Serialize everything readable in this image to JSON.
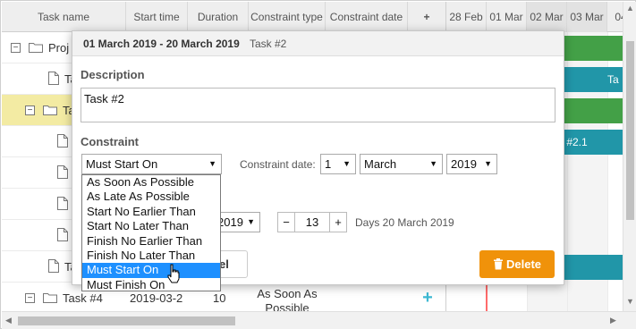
{
  "grid": {
    "columns": [
      {
        "key": "task_name",
        "label": "Task name"
      },
      {
        "key": "start_time",
        "label": "Start time"
      },
      {
        "key": "duration",
        "label": "Duration"
      },
      {
        "key": "constraint_type",
        "label": "Constraint type"
      },
      {
        "key": "constraint_date",
        "label": "Constraint date"
      }
    ],
    "add_icon": "plus-icon",
    "rows": [
      {
        "name": "Proj",
        "type": "project",
        "expanded": true
      },
      {
        "name": "Ta",
        "type": "task"
      },
      {
        "name": "Ta",
        "type": "project",
        "expanded": true,
        "selected": true
      },
      {
        "name": "",
        "type": "task"
      },
      {
        "name": "",
        "type": "task"
      },
      {
        "name": "",
        "type": "task"
      },
      {
        "name": "",
        "type": "task"
      },
      {
        "name": "Ta",
        "type": "task"
      },
      {
        "name": "Task #4",
        "type": "project",
        "expanded": true,
        "start": "2019-03-2",
        "duration": "10",
        "constraint": "As Soon As Possible"
      }
    ]
  },
  "scale": {
    "days": [
      {
        "label": "28 Feb",
        "weekend": false
      },
      {
        "label": "01 Mar",
        "weekend": false
      },
      {
        "label": "02 Mar",
        "weekend": true
      },
      {
        "label": "03 Mar",
        "weekend": true
      },
      {
        "label": "04",
        "weekend": false
      }
    ]
  },
  "timeline": {
    "bars": [
      {
        "row": 0,
        "color": "#43a047",
        "label": ""
      },
      {
        "row": 1,
        "color": "#2196a8",
        "label": "Ta"
      },
      {
        "row": 2,
        "color": "#43a047",
        "label": ""
      },
      {
        "row": 3,
        "color": "#2196a8",
        "label": "k #2.1"
      },
      {
        "row": 7,
        "color": "#2196a8",
        "label": ""
      }
    ]
  },
  "lightbox": {
    "date_range": "01 March 2019 - 20 March 2019",
    "task_title": "Task #2",
    "description_label": "Description",
    "description_value": "Task #2",
    "constraint_label": "Constraint",
    "constraint_type_selected": "Must Start On",
    "constraint_date_label": "Constraint date:",
    "constraint_day": "1",
    "constraint_month": "March",
    "constraint_year": "2019",
    "duration_year": "2019",
    "duration_minus": "−",
    "duration_value": "13",
    "duration_plus": "+",
    "duration_text": "Days 20 March 2019",
    "constraint_options": [
      "As Soon As Possible",
      "As Late As Possible",
      "Start No Earlier Than",
      "Start No Later Than",
      "Finish No Earlier Than",
      "Finish No Later Than",
      "Must Start On",
      "Must Finish On"
    ],
    "highlighted_option": "Must Start On",
    "cancel_label_visible": "el",
    "delete_label": "Delete",
    "delete_icon": "trash-icon"
  },
  "colors": {
    "accent": "#3db9d3",
    "green_bar": "#43a047",
    "blue_bar": "#2196a8",
    "selected_row": "#f3eba3",
    "delete_button": "#f0920a",
    "dropdown_highlight": "#1e90ff",
    "today_marker": "#ff6b6b"
  }
}
